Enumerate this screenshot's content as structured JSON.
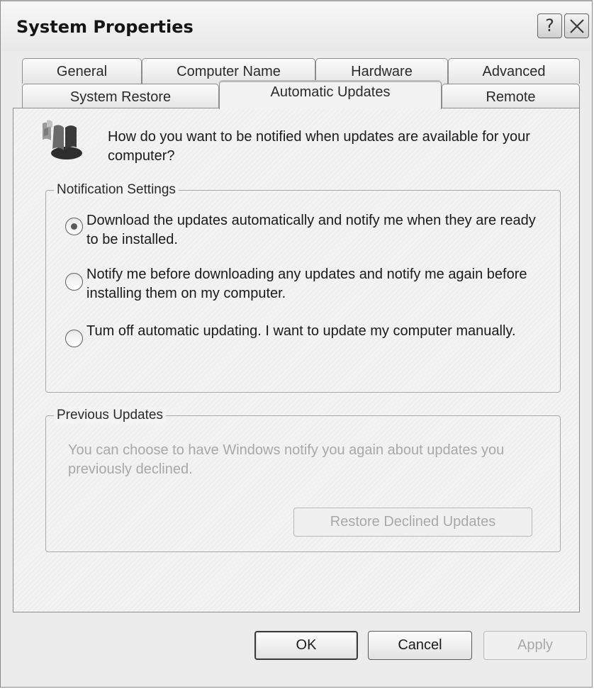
{
  "window": {
    "title": "System Properties",
    "help_glyph": "?",
    "close_icon": "close-icon"
  },
  "tabs": {
    "back_row": [
      {
        "label": "General"
      },
      {
        "label": "Computer Name"
      },
      {
        "label": "Hardware"
      },
      {
        "label": "Advanced"
      }
    ],
    "front_row": [
      {
        "label": "System Restore"
      },
      {
        "label": "Automatic Updates",
        "selected": true
      },
      {
        "label": "Remote"
      }
    ]
  },
  "content": {
    "icon": "automatic-updates-icon",
    "question": "How do you want to be notified when updates are available for your computer?"
  },
  "notification_settings": {
    "legend": "Notification Settings",
    "selected_index": 0,
    "options": [
      {
        "label": "Download the updates automatically and notify me when they are ready to be installed."
      },
      {
        "label": "Notify me before downloading any updates and notify me again before installing them on my computer."
      },
      {
        "label": "Tum off automatic updating. I want to update my computer manually."
      }
    ]
  },
  "previous_updates": {
    "legend": "Previous Updates",
    "description": "You can choose to have Windows notify you again about updates you previously declined.",
    "restore_button": "Restore Declined Updates",
    "restore_enabled": false
  },
  "footer": {
    "ok": "OK",
    "cancel": "Cancel",
    "apply": "Apply",
    "apply_enabled": false
  },
  "colors": {
    "window_face": "#ececec",
    "panel_face": "#f3f3f3",
    "disabled_text": "#a8a8a8"
  }
}
